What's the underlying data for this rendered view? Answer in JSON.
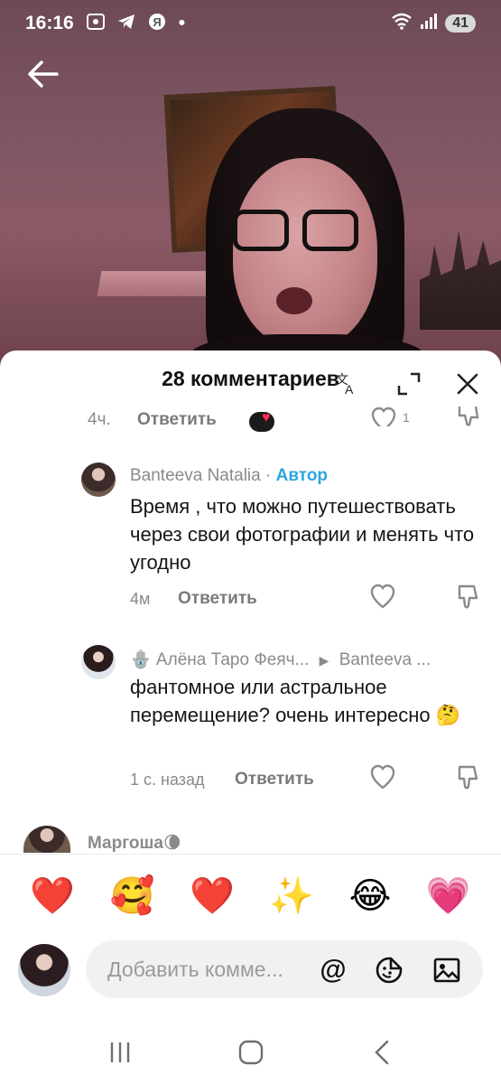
{
  "status_bar": {
    "time": "16:16",
    "indicators": [
      "screen-record-icon",
      "telegram-icon",
      "yandex-icon"
    ],
    "dot": "•",
    "battery": "41"
  },
  "sheet": {
    "title": "28 комментариев"
  },
  "previous_comment": {
    "time": "4ч.",
    "reply_label": "Ответить"
  },
  "comments": [
    {
      "username": "Banteeva Natalia",
      "separator": "·",
      "author_badge": "Автор",
      "text": "Время , что можно путешествовать через свои фотографии и менять что угодно",
      "time": "4м",
      "reply_label": "Ответить"
    },
    {
      "username": "🪬 Алёна Таро Феяч...",
      "reply_to": "Banteeva ...",
      "text": "фантомное или астральное перемещение? очень интересно 🤔",
      "time": "1 с. назад",
      "reply_label": "Ответить"
    },
    {
      "username": "Маргоша🌘"
    }
  ],
  "quick_emojis": [
    "❤️",
    "🥰",
    "❤️",
    "✨",
    "😂",
    "💗"
  ],
  "input": {
    "placeholder": "Добавить комме...",
    "at_symbol": "@"
  },
  "colors": {
    "author_accent": "#2ba6de",
    "like_red": "#ff2d55"
  }
}
